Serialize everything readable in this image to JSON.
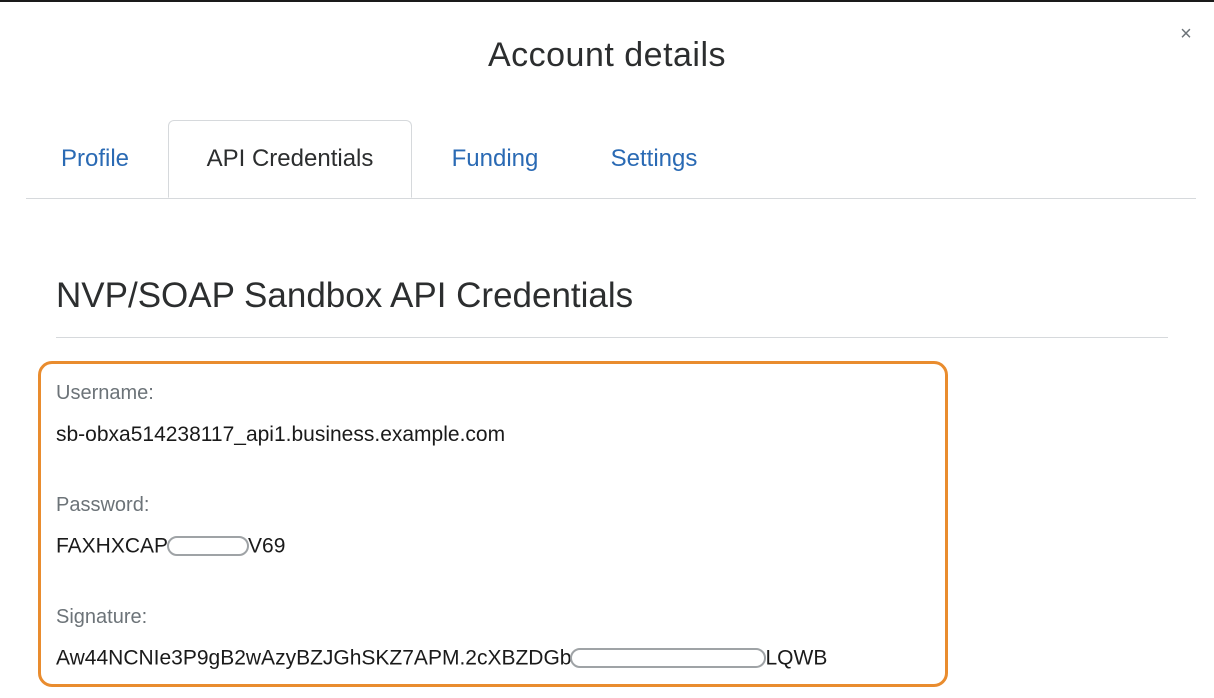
{
  "dialog": {
    "title": "Account details",
    "close_symbol": "×"
  },
  "tabs": [
    {
      "label": "Profile",
      "active": false
    },
    {
      "label": "API Credentials",
      "active": true
    },
    {
      "label": "Funding",
      "active": false
    },
    {
      "label": "Settings",
      "active": false
    }
  ],
  "section": {
    "title": "NVP/SOAP Sandbox API Credentials"
  },
  "credentials": {
    "username": {
      "label": "Username:",
      "value": "sb-obxa514238117_api1.business.example.com"
    },
    "password": {
      "label": "Password:",
      "value_prefix": "FAXHXCAP",
      "value_suffix": "V69",
      "redacted": true
    },
    "signature": {
      "label": "Signature:",
      "value_prefix": "Aw44NCNIe3P9gB2wAzyBZJGhSKZ7APM.2cXBZDGb",
      "value_suffix": "LQWB",
      "redacted": true
    }
  },
  "colors": {
    "accent_link": "#2a6ab4",
    "highlight_border": "#e98c2e",
    "text_primary": "#2c2e2f",
    "text_muted": "#6c7378"
  }
}
